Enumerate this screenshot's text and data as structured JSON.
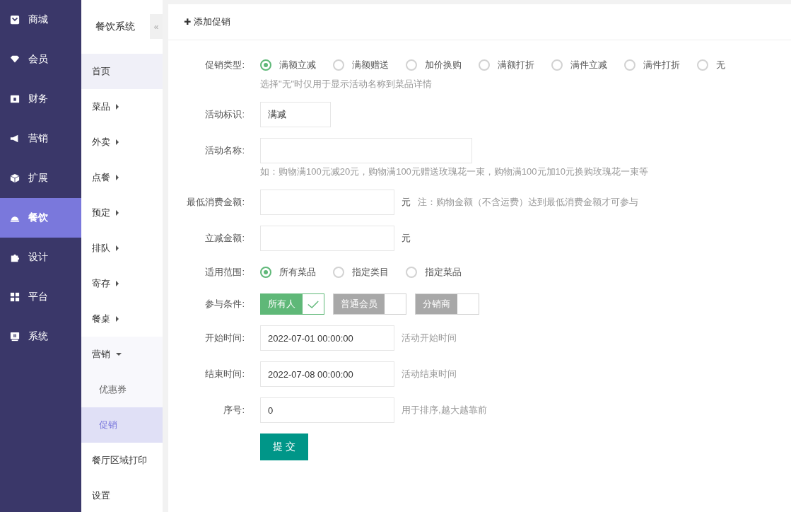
{
  "main_nav": [
    {
      "label": "商城",
      "selected": false
    },
    {
      "label": "会员",
      "selected": false
    },
    {
      "label": "财务",
      "selected": false
    },
    {
      "label": "营销",
      "selected": false
    },
    {
      "label": "扩展",
      "selected": false
    },
    {
      "label": "餐饮",
      "selected": true
    },
    {
      "label": "设计",
      "selected": false
    },
    {
      "label": "平台",
      "selected": false
    },
    {
      "label": "系统",
      "selected": false
    }
  ],
  "sub_nav": {
    "title": "餐饮系统",
    "collapse": "«",
    "items": [
      {
        "label": "首页",
        "kind": "link",
        "selected": false,
        "hovered": true
      },
      {
        "label": "菜品",
        "kind": "group",
        "expanded": false
      },
      {
        "label": "外卖",
        "kind": "group",
        "expanded": false
      },
      {
        "label": "点餐",
        "kind": "group",
        "expanded": false
      },
      {
        "label": "预定",
        "kind": "group",
        "expanded": false
      },
      {
        "label": "排队",
        "kind": "group",
        "expanded": false
      },
      {
        "label": "寄存",
        "kind": "group",
        "expanded": false
      },
      {
        "label": "餐桌",
        "kind": "group",
        "expanded": false
      },
      {
        "label": "营销",
        "kind": "group",
        "expanded": true,
        "children": [
          {
            "label": "优惠券",
            "selected": false
          },
          {
            "label": "促销",
            "selected": true
          }
        ]
      },
      {
        "label": "餐厅区域打印",
        "kind": "link",
        "selected": false,
        "hovered": false
      },
      {
        "label": "设置",
        "kind": "link",
        "selected": false,
        "hovered": false
      }
    ]
  },
  "header": {
    "icon": "✚",
    "title": "添加促销"
  },
  "form": {
    "rows": [
      {
        "kind": "radio",
        "label": "促销类型:",
        "options": [
          {
            "label": "满额立减",
            "selected": true
          },
          {
            "label": "满额赠送",
            "selected": false
          },
          {
            "label": "加价换购",
            "selected": false
          },
          {
            "label": "满额打折",
            "selected": false
          },
          {
            "label": "满件立减",
            "selected": false
          },
          {
            "label": "满件打折",
            "selected": false
          },
          {
            "label": "无",
            "selected": false
          }
        ],
        "hint": "选择\"无\"时仅用于显示活动名称到菜品详情"
      },
      {
        "kind": "input",
        "label": "活动标识:",
        "value": "满减"
      },
      {
        "kind": "input",
        "label": "活动名称:",
        "hint": "如：购物满100元减20元，购物满100元赠送玫瑰花一束，购物满100元加10元换购玫瑰花一束等"
      },
      {
        "kind": "input",
        "label": "最低消费金额:",
        "suffix": "元",
        "note": "注：购物金额（不含运费）达到最低消费金额才可参与"
      },
      {
        "kind": "input",
        "label": "立减金额:",
        "suffix": "元"
      },
      {
        "kind": "radio",
        "label": "适用范围:",
        "options": [
          {
            "label": "所有菜品",
            "selected": true
          },
          {
            "label": "指定类目",
            "selected": false
          },
          {
            "label": "指定菜品",
            "selected": false
          }
        ]
      },
      {
        "kind": "checkbox",
        "label": "参与条件:",
        "options": [
          {
            "label": "所有人",
            "checked": true
          },
          {
            "label": "普通会员",
            "checked": false
          },
          {
            "label": "分销商",
            "checked": false
          }
        ]
      },
      {
        "kind": "input",
        "label": "开始时间:",
        "value": "2022-07-01 00:00:00",
        "note": "活动开始时间"
      },
      {
        "kind": "input",
        "label": "结束时间:",
        "value": "2022-07-08 00:00:00",
        "note": "活动结束时间"
      },
      {
        "kind": "input",
        "label": "序号:",
        "value": "0",
        "note": "用于排序,越大越靠前"
      }
    ],
    "submit": "提 交"
  }
}
